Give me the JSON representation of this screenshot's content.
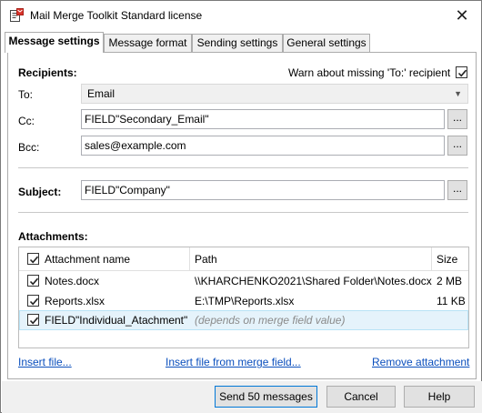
{
  "window": {
    "title": "Mail Merge Toolkit Standard license",
    "close_glyph": "✕"
  },
  "tabs": [
    {
      "label": "Message settings",
      "active": true
    },
    {
      "label": "Message format",
      "active": false
    },
    {
      "label": "Sending settings",
      "active": false
    },
    {
      "label": "General settings",
      "active": false
    }
  ],
  "recipients": {
    "heading": "Recipients:",
    "warn_label": "Warn about missing 'To:' recipient",
    "warn_checked": true,
    "to_label": "To:",
    "to_value": "Email",
    "cc_label": "Cc:",
    "cc_value": "FIELD\"Secondary_Email\"",
    "bcc_label": "Bcc:",
    "bcc_value": "sales@example.com",
    "browse_label": "..."
  },
  "subject": {
    "label": "Subject:",
    "value": "FIELD\"Company\"",
    "browse_label": "..."
  },
  "attachments": {
    "heading": "Attachments:",
    "columns": {
      "name": "Attachment name",
      "path": "Path",
      "size": "Size"
    },
    "header_checked": true,
    "rows": [
      {
        "name": "Notes.docx",
        "path": "\\\\KHARCHENKO2021\\Shared Folder\\Notes.docx",
        "size": "2 MB",
        "checked": true,
        "selected": false
      },
      {
        "name": "Reports.xlsx",
        "path": "E:\\TMP\\Reports.xlsx",
        "size": "11 KB",
        "checked": true,
        "selected": false
      },
      {
        "name": "FIELD\"Individual_Atachment\"",
        "path": "(depends on merge field value)",
        "size": "",
        "checked": true,
        "selected": true
      }
    ],
    "links": {
      "insert_file": "Insert file...",
      "insert_from_field": "Insert file from merge field...",
      "remove": "Remove attachment"
    }
  },
  "footer": {
    "send_label": "Send 50 messages",
    "cancel_label": "Cancel",
    "help_label": "Help"
  },
  "colors": {
    "link": "#0b4fbd",
    "selection": "#e5f3fb",
    "default_button_border": "#0078d7"
  }
}
